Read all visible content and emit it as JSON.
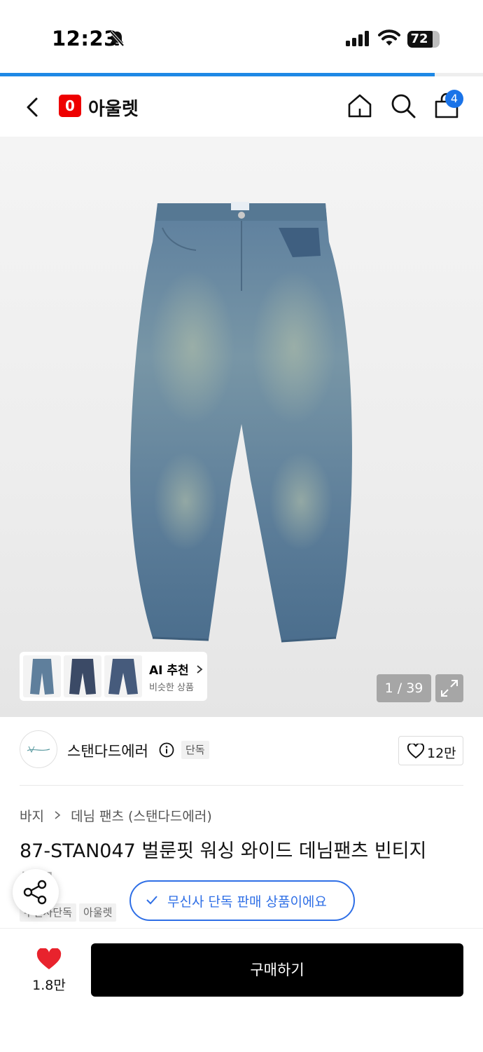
{
  "status_bar": {
    "time": "12:23",
    "battery": "72"
  },
  "page_load_progress": 0.9,
  "header": {
    "logo_letter": "0",
    "title": "아울렛",
    "cart_count": "4"
  },
  "gallery": {
    "ai_title": "AI 추천",
    "ai_subtitle": "비슷한 상품",
    "page_counter": "1 / 39"
  },
  "brand": {
    "name": "스탠다드에러",
    "tag": "단독",
    "likes": "12만"
  },
  "breadcrumb": [
    "바지",
    "데님 팬츠 (스탠다드에러)"
  ],
  "product": {
    "title": "87-STAN047 벌룬핏 워싱 와이드 데님팬츠 빈티지",
    "title_overflow": "블루"
  },
  "tags": [
    "무신사단독",
    "아울렛"
  ],
  "toast": "무신사 단독 판매 상품이에요",
  "bottom_bar": {
    "wish_count": "1.8만",
    "buy_label": "구매하기"
  },
  "colors": {
    "accent_blue": "#2f6fe6",
    "badge_blue": "#1a73e8",
    "heart_red": "#e8232d",
    "brand_red": "#ee0000"
  }
}
